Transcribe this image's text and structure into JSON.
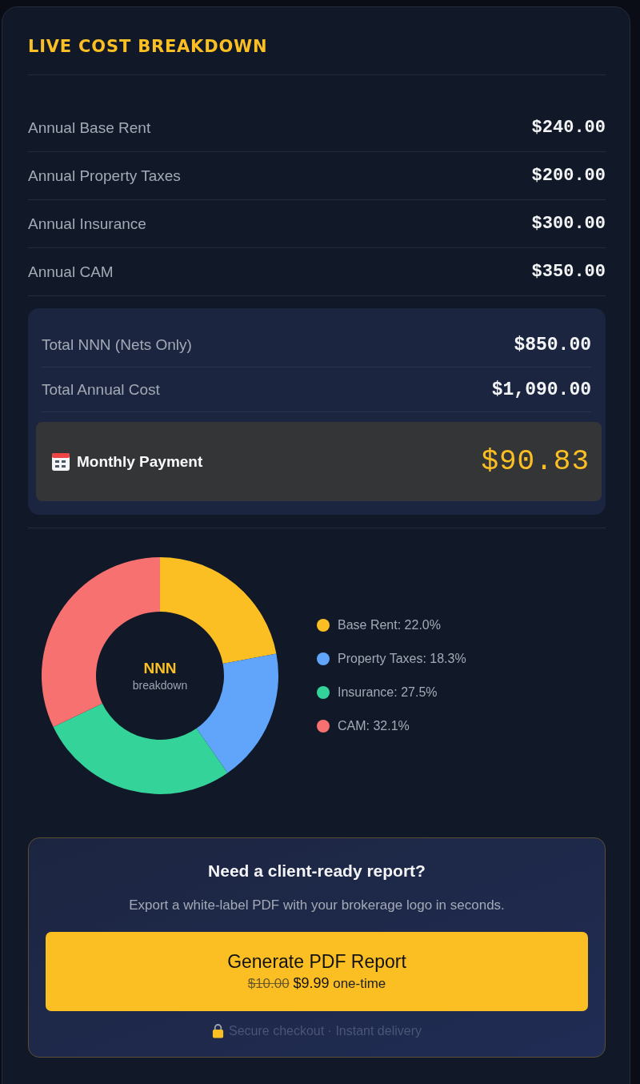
{
  "title": "LIVE COST BREAKDOWN",
  "cost_rows": [
    {
      "label": "Annual Base Rent",
      "value": "$240.00"
    },
    {
      "label": "Annual Property Taxes",
      "value": "$200.00"
    },
    {
      "label": "Annual Insurance",
      "value": "$300.00"
    },
    {
      "label": "Annual CAM",
      "value": "$350.00"
    }
  ],
  "totals": {
    "rows": [
      {
        "label": "Total NNN (Nets Only)",
        "value": "$850.00"
      },
      {
        "label": "Total Annual Cost",
        "value": "$1,090.00"
      }
    ],
    "monthly": {
      "label": "Monthly Payment",
      "value": "$90.83"
    }
  },
  "cost_chart": {
    "center_title": "NNN",
    "center_subtitle": "breakdown",
    "chart_data": {
      "type": "donut",
      "categories": [
        "Base Rent: 22.0%",
        "Property Taxes: 18.3%",
        "Insurance: 27.5%",
        "CAM: 32.1%"
      ],
      "values": [
        22.0,
        18.3,
        27.5,
        32.1
      ],
      "colors": [
        "#fbbf24",
        "#60a5fa",
        "#34d399",
        "#f87171"
      ]
    }
  },
  "cta": {
    "heading": "Need a client-ready report?",
    "subtext": "Export a white-label PDF with your brokerage logo in seconds.",
    "button": {
      "label": "Generate PDF Report",
      "old_price": "$10.00",
      "price": "$9.99",
      "note": "one-time"
    },
    "footer": "Secure checkout · Instant delivery"
  }
}
